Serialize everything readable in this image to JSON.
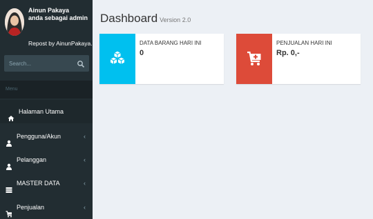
{
  "user": {
    "name": "Ainun Pakaya",
    "role": "anda sebagai admin",
    "repost": "Repost by AinunPakaya.c"
  },
  "search": {
    "placeholder": "Search..."
  },
  "menu": {
    "header": "Menu",
    "items": [
      {
        "label": "Halaman Utama",
        "icon": "home-icon",
        "active": true
      },
      {
        "label": "Pengguna/Akun",
        "icon": "user-icon",
        "chevron": "‹"
      },
      {
        "label": "Pelanggan",
        "icon": "user-icon",
        "chevron": "‹"
      },
      {
        "label": "MASTER DATA",
        "icon": "table-icon",
        "chevron": "‹"
      },
      {
        "label": "Penjualan",
        "icon": "cart-icon",
        "chevron": "‹"
      }
    ]
  },
  "page": {
    "title": "Dashboard",
    "subtitle": "Version 2.0"
  },
  "info_boxes": [
    {
      "label": "DATA BARANG HARI INI",
      "value": "0",
      "icon": "cubes-icon",
      "color": "#00c0ef"
    },
    {
      "label": "PENJUALAN HARI INI",
      "value": "Rp. 0,-",
      "icon": "cart-plus-icon",
      "color": "#dd4b39"
    }
  ],
  "colors": {
    "sidebar_bg": "#222d32",
    "content_bg": "#ecf0f5",
    "aqua": "#00c0ef",
    "red": "#dd4b39"
  }
}
